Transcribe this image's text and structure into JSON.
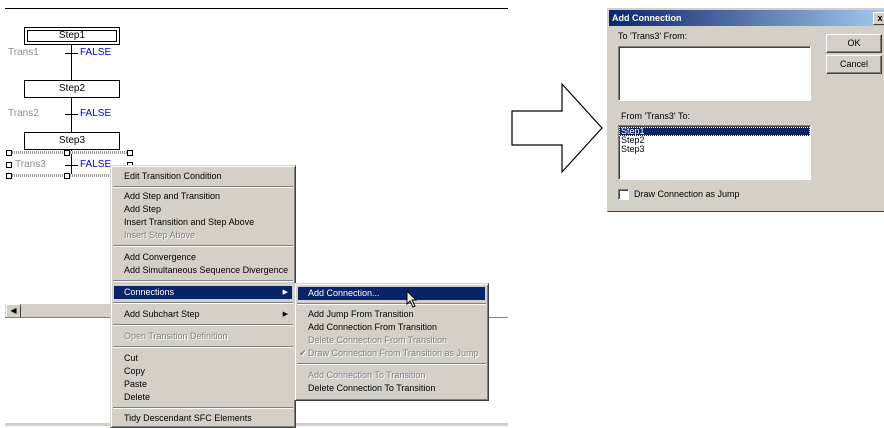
{
  "sfc": {
    "steps": [
      "Step1",
      "Step2",
      "Step3"
    ],
    "transitions": [
      {
        "name": "Trans1",
        "value": "FALSE"
      },
      {
        "name": "Trans2",
        "value": "FALSE"
      },
      {
        "name": "Trans3",
        "value": "FALSE"
      }
    ]
  },
  "context_menu": {
    "items": [
      "Edit Transition Condition",
      "Add Step and Transition",
      "Add Step",
      "Insert Transition and Step Above",
      "Insert Step Above",
      "Add Convergence",
      "Add Simultaneous Sequence Divergence",
      "Connections",
      "Add Subchart Step",
      "Open Transition Definition",
      "Cut",
      "Copy",
      "Paste",
      "Delete",
      "Tidy Descendant SFC Elements"
    ]
  },
  "submenu": {
    "items": [
      "Add Connection...",
      "Add Jump From Transition",
      "Add Connection From Transition",
      "Delete Connection From Transition",
      "Draw Connection From Transition as Jump",
      "Add Connection To Transition",
      "Delete Connection To Transition"
    ]
  },
  "dialog": {
    "title": "Add Connection",
    "close_glyph": "x",
    "to_label": "To 'Trans3' From:",
    "from_label": "From 'Trans3' To:",
    "to_list": [
      "Step1",
      "Step2",
      "Step3"
    ],
    "selected_index": 0,
    "ok_label": "OK",
    "cancel_label": "Cancel",
    "checkbox_label": "Draw Connection as Jump",
    "checkbox_checked": false
  },
  "colors": {
    "menu_bg": "#d4d0c8",
    "selection": "#0a246a",
    "transition_value": "#0000e0",
    "transition_name": "#8c8c8c"
  },
  "icons": [
    "arrow-right-icon",
    "mouse-cursor-icon",
    "submenu-arrow-icon",
    "check-icon",
    "scroll-left-icon"
  ]
}
